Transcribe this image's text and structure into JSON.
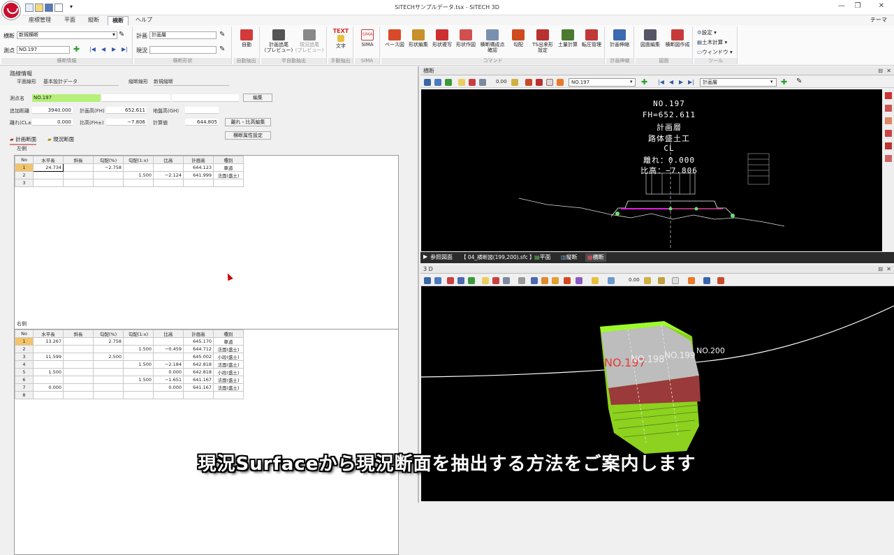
{
  "app": {
    "title": "SiTECHサンプルデータ.tsx - SiTECH 3D",
    "theme_label": "テーマ",
    "minimize": "—",
    "restore": "❐",
    "close": "✕"
  },
  "menu": [
    "座標管理",
    "平面",
    "縦断",
    "横断",
    "ヘルプ"
  ],
  "menu_active_index": 3,
  "ribbon": {
    "group1": {
      "label": "横断情報",
      "row1_label": "横断",
      "row1_value": "新規横断",
      "row2_label": "測点",
      "row2_value": "NO.197"
    },
    "group2": {
      "label": "横断形状",
      "row1_label": "計画",
      "row1_value": "計画層",
      "row2_label": "現況",
      "row2_value": ""
    },
    "auto": {
      "btn": "自動",
      "label": "自動抽出"
    },
    "semi": {
      "btn1": "計画追尾\n(プレビュー)",
      "btn2": "現況追尾\n(プレビュー)",
      "label": "半自動抽出"
    },
    "manual": {
      "btn": "文字",
      "icon_text": "TEXT",
      "label": "手動抽出"
    },
    "sima": {
      "btn": "SIMA",
      "icon_text": "SIMA",
      "label": "SIMA"
    },
    "commands": {
      "label": "コマンド",
      "buttons": [
        "ベース図",
        "形状編集",
        "形状複写",
        "形状作図",
        "横断構成点\n確認",
        "勾配",
        "TS出来形\n設定",
        "土量計算",
        "転圧管理"
      ]
    },
    "plan": {
      "btn": "計画伸縮",
      "label": "計画伸縮"
    },
    "drawing": {
      "btn1": "図面編集",
      "btn2": "横断図作成",
      "label": "図面"
    },
    "tools": {
      "items": [
        "設定",
        "土木計算",
        "ウィンドウ"
      ],
      "label": "ツール"
    }
  },
  "route": {
    "section_title": "路線情報",
    "plan_label": "平面線形",
    "plan_value": "基本設計データ",
    "profile_label": "縦断線形",
    "profile_value": "新規縦断"
  },
  "station": {
    "name_label": "測点名",
    "name_value": "NO.197",
    "edit_button": "編集",
    "add_dist_label": "追加距離",
    "add_dist_value": "3940.000",
    "fh_label": "計画高(FH)",
    "fh_value": "652.611",
    "gh_label": "地盤高(GH)",
    "gh_value": "",
    "offset_label": "離れ(CL±)",
    "offset_value": "0.000",
    "ratio_label": "比高(FH±)",
    "ratio_value": "−7.806",
    "calc_label": "計算値",
    "calc_value": "644.805",
    "offset_edit_button": "離れ・比高編集",
    "attr_button": "横断属性設定"
  },
  "tabs": {
    "plan": "計画断面",
    "current": "現況断面"
  },
  "left_table": {
    "title": "左側",
    "headers": [
      "No",
      "水平長",
      "斜長",
      "勾配(%)",
      "勾配(1:x)",
      "比高",
      "計画高",
      "種別"
    ],
    "rows": [
      [
        "1",
        "24.734",
        "",
        "−2.758",
        "",
        "",
        "644.123",
        "車道"
      ],
      [
        "2",
        "",
        "",
        "",
        "1.500",
        "−2.124",
        "641.999",
        "法面(盛土)"
      ],
      [
        "3",
        "",
        "",
        "",
        "",
        "",
        "",
        ""
      ]
    ]
  },
  "right_table": {
    "title": "右側",
    "headers": [
      "No",
      "水平長",
      "斜長",
      "勾配(%)",
      "勾配(1:x)",
      "比高",
      "計画高",
      "種別"
    ],
    "rows": [
      [
        "1",
        "13.267",
        "",
        "2.758",
        "",
        "",
        "645.170",
        "車道"
      ],
      [
        "2",
        "",
        "",
        "",
        "1.500",
        "−0.459",
        "644.712",
        "法面(盛土)"
      ],
      [
        "3",
        "11.599",
        "",
        "2.500",
        "",
        "",
        "645.002",
        "小段(盛土)"
      ],
      [
        "4",
        "",
        "",
        "",
        "1.500",
        "−2.184",
        "642.818",
        "法面(盛土)"
      ],
      [
        "5",
        "1.500",
        "",
        "",
        "",
        "0.000",
        "642.818",
        "小段(盛土)"
      ],
      [
        "6",
        "",
        "",
        "",
        "1.500",
        "−1.651",
        "641.167",
        "法面(盛土)"
      ],
      [
        "7",
        "0.000",
        "",
        "",
        "",
        "0.000",
        "641.167",
        "法面(盛土)"
      ],
      [
        "8",
        "",
        "",
        "",
        "",
        "",
        "",
        ""
      ]
    ]
  },
  "cross_view": {
    "title": "横断",
    "station_dd": "NO.197",
    "layer_dd": "計画層",
    "zoom": "0.00",
    "lines": [
      "NO.197",
      "FH=652.611",
      "計画層",
      "路体盛土工",
      "CL",
      "離れ：0.000",
      "比高：−7.806"
    ]
  },
  "ref_bar": {
    "label": "参照図面",
    "file": "【 04_横断図(199,200).sfc 】",
    "tab_plan": "平面",
    "tab_profile": "縦断",
    "tab_cross": "横断"
  },
  "view3d": {
    "title": "3 D",
    "labels": [
      "NO.197",
      "NO.198",
      "NO.199",
      "NO.200"
    ]
  },
  "subtitle": "現況Surfaceから現況断面を抽出する方法をご案内します",
  "colors": {
    "accent": "#c8102e",
    "highlight": "#b6f07a",
    "selected_cell": "#f3c36b",
    "fill_green": "#8cd21e"
  }
}
